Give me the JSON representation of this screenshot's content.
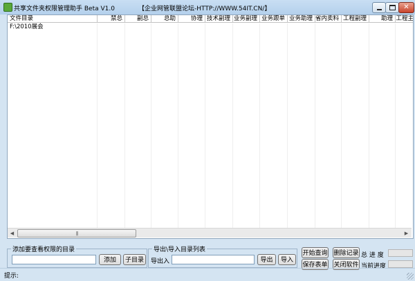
{
  "window": {
    "title": "共享文件夹权限管理助手  Beta V1.0",
    "banner": "【企业网管联盟论坛-HTTP://WWW.54IT.CN/】",
    "minimize_icon": "minimize-icon",
    "maximize_icon": "maximize-icon",
    "close_glyph": "✕"
  },
  "list": {
    "columns": [
      "文件目录",
      "禁总",
      "副总",
      "总助",
      "协理",
      "技术副理",
      "业务副理",
      "业务跟单",
      "业务助理",
      "省内卖料",
      "工程副理",
      "助理",
      "工程主"
    ],
    "rows": [
      [
        "F:\\2010展会"
      ]
    ],
    "scroll_thumb_glyph": "|||"
  },
  "add_group": {
    "title": "添加要查看权限的目录",
    "path_value": "",
    "add_label": "添加",
    "subdir_label": "子目录"
  },
  "export_group": {
    "title": "导出\\导入目录列表",
    "export_import_label": "导出入",
    "path_value": "",
    "export_label": "导出",
    "import_label": "导入"
  },
  "actions": {
    "start_query": "开始查询",
    "delete_record": "删除记录",
    "save_sheet": "保存表单",
    "close_app": "关闭软件",
    "total_progress": "总 进 度",
    "current_progress": "当前进度",
    "total_progress_value": 0,
    "current_progress_value": 0
  },
  "status": {
    "hint": "提示:"
  }
}
